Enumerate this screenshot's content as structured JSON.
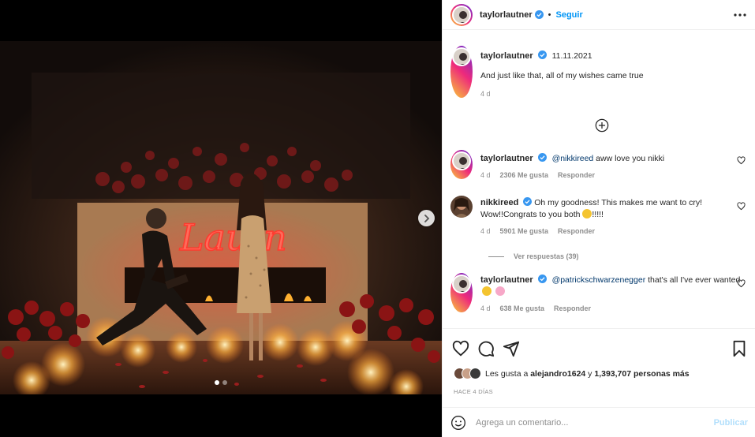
{
  "post": {
    "username": "taylorlautner",
    "follow_label": "Seguir",
    "dot": "•"
  },
  "caption": {
    "username": "taylorlautner",
    "date": "11.11.2021",
    "text": "And just like that, all of my wishes came true",
    "time": "4 d"
  },
  "comments": [
    {
      "username": "taylorlautner",
      "mention": "@nikkireed",
      "text": " aww love you nikki",
      "time": "4 d",
      "likes": "2306 Me gusta",
      "reply": "Responder"
    },
    {
      "username": "nikkireed",
      "text": " Oh my goodness! This makes me want to cry! Wow!!Congrats to you both",
      "text_after": "!!!!!",
      "time": "4 d",
      "likes": "5901 Me gusta",
      "reply": "Responder",
      "view_replies": "Ver respuestas (39)"
    },
    {
      "username": "taylorlautner",
      "mention": "@patrickschwarzenegger",
      "text": " that's all I've ever wanted",
      "time": "4 d",
      "likes": "638 Me gusta",
      "reply": "Responder"
    }
  ],
  "likes": {
    "prefix": "Les gusta a ",
    "user": "alejandro1624",
    "middle": " y ",
    "count": "1,393,707 personas más"
  },
  "posted_ago": "HACE 4 DÍAS",
  "composer": {
    "placeholder": "Agrega un comentario...",
    "publish_label": "Publicar"
  },
  "photo": {
    "neon_sign": "Lautn"
  },
  "colors": {
    "link_blue": "#0095f6",
    "mention_blue": "#00376b",
    "muted": "#8e8e8e",
    "neon": "#ff3a2e"
  },
  "icons": [
    "chevron-right-icon",
    "more-icon",
    "verified-icon",
    "plus-circle-icon",
    "heart-icon",
    "comment-icon",
    "share-icon",
    "bookmark-icon",
    "emoji-icon"
  ]
}
